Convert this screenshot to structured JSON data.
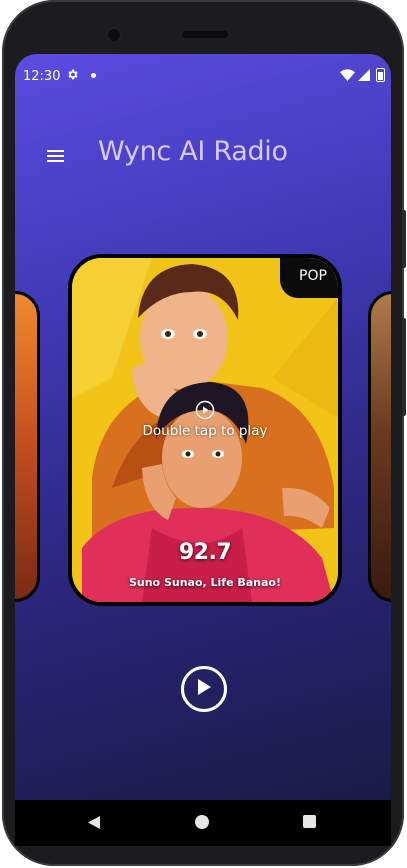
{
  "status_bar": {
    "time": "12:30",
    "icons": [
      "gear-icon",
      "notification-dot-icon",
      "wifi-icon",
      "signal-icon",
      "battery-icon"
    ]
  },
  "header": {
    "menu_icon": "hamburger-menu-icon",
    "title": "Wync AI Radio"
  },
  "station_card": {
    "genre": "POP",
    "hint": "Double tap to play",
    "frequency": "92.7",
    "tagline": "Suno Sunao, Life Banao!"
  },
  "player": {
    "play_icon": "play-icon"
  },
  "nav_bar": {
    "icons": [
      "back-icon",
      "home-icon",
      "recents-icon"
    ]
  },
  "colors": {
    "background_top": "#5a4ce0",
    "background_bottom": "#1a1a45",
    "title": "#d7c9ff",
    "card_art_yellow": "#f2c418",
    "badge_bg": "#0b0b0b"
  }
}
